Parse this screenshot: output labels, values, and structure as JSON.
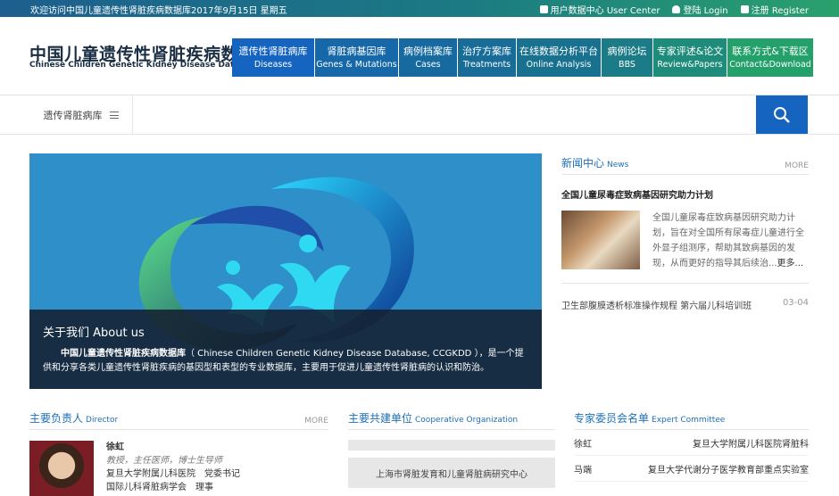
{
  "topbar": {
    "welcome": "欢迎访问中国儿童遗传性肾脏疾病数据库2017年9月15日 星期五",
    "user_center": "用户数据中心 User Center",
    "login": "登陆 Login",
    "register": "注册 Register"
  },
  "header": {
    "title_cn": "中国儿童遗传性肾脏疾病数据库",
    "title_en": "Chinese Children Genetic Kidney Disease Database"
  },
  "nav": [
    {
      "cn": "遗传性肾脏病库",
      "en": "Diseases",
      "color": "#1565c0"
    },
    {
      "cn": "肾脏病基因库",
      "en": "Genes & Mutations",
      "color": "#1768a8"
    },
    {
      "cn": "病例档案库",
      "en": "Cases",
      "color": "#176aa0"
    },
    {
      "cn": "治疗方案库",
      "en": "Treatments",
      "color": "#186c98"
    },
    {
      "cn": "在线数据分析平台",
      "en": "Online Analysis",
      "color": "#197190"
    },
    {
      "cn": "病例论坛",
      "en": "BBS",
      "color": "#1b7b86"
    },
    {
      "cn": "专家评述&论文",
      "en": "Review&Papers",
      "color": "#1f8b7a"
    },
    {
      "cn": "联系方式&下载区",
      "en": "Contact&Download",
      "color": "#24a06a"
    }
  ],
  "search": {
    "category": "遗传肾脏病库",
    "placeholder": ""
  },
  "about": {
    "title": "关于我们 About us",
    "name": "中国儿童遗传性肾脏疾病数据库",
    "desc": "（ Chinese Children Genetic Kidney Disease Database, CCGKDD ），是一个提供和分享各类儿童遗传性肾脏疾病的基因型和表型的专业数据库，主要用于促进儿童遗传性肾脏病的认识和防治。"
  },
  "news": {
    "title_cn": "新闻中心",
    "title_en": "News",
    "more": "MORE",
    "headline": "全国儿童尿毒症致病基因研究助力计划",
    "summary": "全国儿童尿毒症致病基因研究助力计划，旨在对全国所有尿毒症儿童进行全外显子组测序，帮助其致病基因的发现，从而更好的指导其后续治...",
    "more_link": "更多...",
    "item": "卫生部腹膜透析标准操作规程 第六届儿科培训班",
    "item_date": "03-04"
  },
  "director": {
    "title_cn": "主要负责人",
    "title_en": "Director",
    "more": "MORE",
    "name": "徐虹",
    "titles": "教授，主任医师，博士生导师",
    "l1": "复旦大学附属儿科医院　党委书记",
    "l2": "国际儿科肾脏病学会　理事"
  },
  "org": {
    "title_cn": "主要共建单位",
    "title_en": "Cooperative Organization",
    "name": "上海市肾脏发育和儿童肾脏病研究中心"
  },
  "experts": {
    "title_cn": "专家委员会名单",
    "title_en": "Expert Committee",
    "rows": [
      {
        "name": "徐虹",
        "org": "复旦大学附属儿科医院肾脏科"
      },
      {
        "name": "马端",
        "org": "复旦大学代谢分子医学教育部重点实验室"
      }
    ]
  }
}
